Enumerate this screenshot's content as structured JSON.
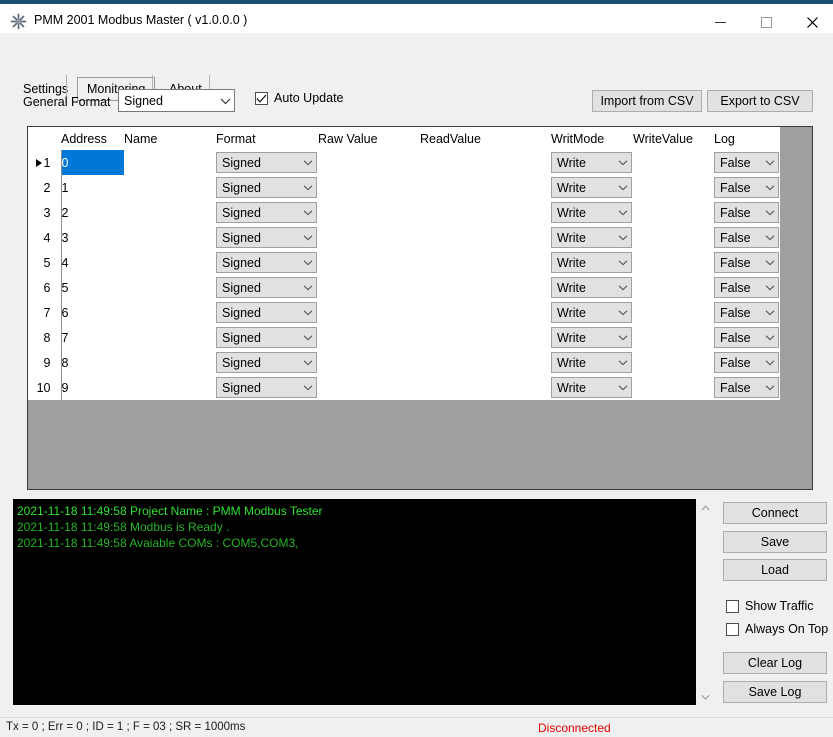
{
  "window": {
    "title": "PMM 2001 Modbus Master ( v1.0.0.0 )",
    "app_icon": "snowflake-icon",
    "minimize_label": "—",
    "maximize_label": "☐",
    "close_label": "✕",
    "accent_color": "#1b4f72"
  },
  "tabs": [
    {
      "label": "Settings",
      "selected": false
    },
    {
      "label": "Monitoring",
      "selected": true
    },
    {
      "label": "About",
      "selected": false
    }
  ],
  "toolbar": {
    "general_format_label": "General Format",
    "general_format_value": "Signed",
    "general_format_options": [
      "Signed"
    ],
    "auto_update_label": "Auto Update",
    "auto_update_checked": true,
    "import_csv_label": "Import from CSV",
    "export_csv_label": "Export to CSV"
  },
  "grid": {
    "columns": [
      "",
      "Address",
      "Name",
      "Format",
      "Raw Value",
      "ReadValue",
      "WritMode",
      "WriteValue",
      "Log"
    ],
    "selected_cell": {
      "row": 0,
      "column": "Address"
    },
    "selected_row_index": 1,
    "rows": [
      {
        "num": "1",
        "address": "0",
        "name": "",
        "format": "Signed",
        "raw_value": "",
        "read_value": "",
        "writ_mode": "Write",
        "write_value": "",
        "log": "False"
      },
      {
        "num": "2",
        "address": "1",
        "name": "",
        "format": "Signed",
        "raw_value": "",
        "read_value": "",
        "writ_mode": "Write",
        "write_value": "",
        "log": "False"
      },
      {
        "num": "3",
        "address": "2",
        "name": "",
        "format": "Signed",
        "raw_value": "",
        "read_value": "",
        "writ_mode": "Write",
        "write_value": "",
        "log": "False"
      },
      {
        "num": "4",
        "address": "3",
        "name": "",
        "format": "Signed",
        "raw_value": "",
        "read_value": "",
        "writ_mode": "Write",
        "write_value": "",
        "log": "False"
      },
      {
        "num": "5",
        "address": "4",
        "name": "",
        "format": "Signed",
        "raw_value": "",
        "read_value": "",
        "writ_mode": "Write",
        "write_value": "",
        "log": "False"
      },
      {
        "num": "6",
        "address": "5",
        "name": "",
        "format": "Signed",
        "raw_value": "",
        "read_value": "",
        "writ_mode": "Write",
        "write_value": "",
        "log": "False"
      },
      {
        "num": "7",
        "address": "6",
        "name": "",
        "format": "Signed",
        "raw_value": "",
        "read_value": "",
        "writ_mode": "Write",
        "write_value": "",
        "log": "False"
      },
      {
        "num": "8",
        "address": "7",
        "name": "",
        "format": "Signed",
        "raw_value": "",
        "read_value": "",
        "writ_mode": "Write",
        "write_value": "",
        "log": "False"
      },
      {
        "num": "9",
        "address": "8",
        "name": "",
        "format": "Signed",
        "raw_value": "",
        "read_value": "",
        "writ_mode": "Write",
        "write_value": "",
        "log": "False"
      },
      {
        "num": "10",
        "address": "9",
        "name": "",
        "format": "Signed",
        "raw_value": "",
        "read_value": "",
        "writ_mode": "Write",
        "write_value": "",
        "log": "False"
      }
    ]
  },
  "log_console": {
    "background_color": "#000000",
    "text_color": "#22b422",
    "lines": [
      "2021-11-18 11:49:58 Project Name : PMM Modbus Tester",
      "2021-11-18 11:49:58 Modbus is Ready .",
      "2021-11-18 11:49:58 Avaiable COMs : COM5,COM3,"
    ]
  },
  "right_panel": {
    "connect_label": "Connect",
    "save_label": "Save",
    "load_label": "Load",
    "show_traffic_label": "Show Traffic",
    "show_traffic_checked": false,
    "always_on_top_label": "Always On Top",
    "always_on_top_checked": false,
    "clear_log_label": "Clear Log",
    "save_log_label": "Save Log"
  },
  "status_bar": {
    "left_text": "Tx = 0 ; Err = 0 ; ID = 1 ; F = 03 ; SR = 1000ms",
    "right_text": "Disconnected",
    "right_color": "#e00000"
  }
}
